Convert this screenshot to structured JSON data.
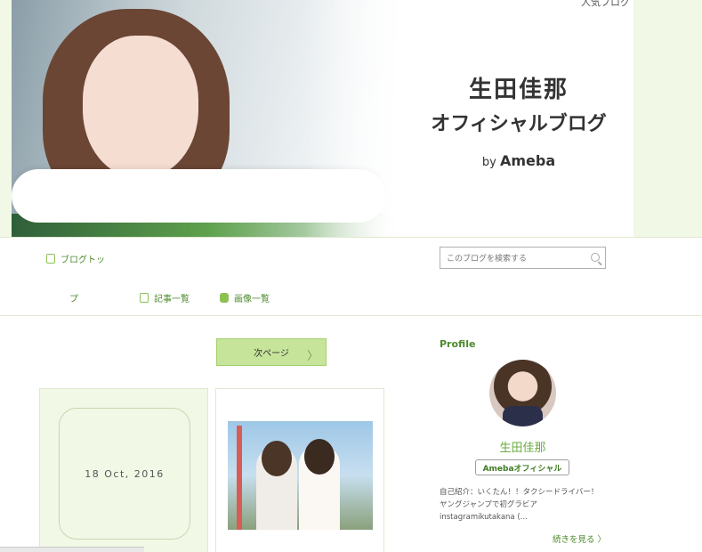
{
  "header": {
    "top_link": "人気ブログ",
    "title_line1": "生田佳那",
    "title_line2": "オフィシャルブログ",
    "by": "by",
    "brand": "Ameba"
  },
  "nav": {
    "blog_top_line1": "ブログトッ",
    "blog_top_line2": "プ",
    "articles": "記事一覧",
    "images": "画像一覧",
    "search_placeholder": "このブログを検索する"
  },
  "main": {
    "next_page": "次ページ",
    "date": "18 Oct, 2016"
  },
  "sidebar": {
    "title": "Profile",
    "name": "生田佳那",
    "badge": "Amebaオフィシャル",
    "intro": "自己紹介：いくたん！！タクシードライバー！ ヤングジャンプで初グラビア instagramikutakana (...",
    "more": "続きを見る"
  },
  "colors": {
    "accent_green": "#4e8a2e",
    "light_green_bg": "#f1f8e6",
    "button_green": "#c6e59a"
  }
}
